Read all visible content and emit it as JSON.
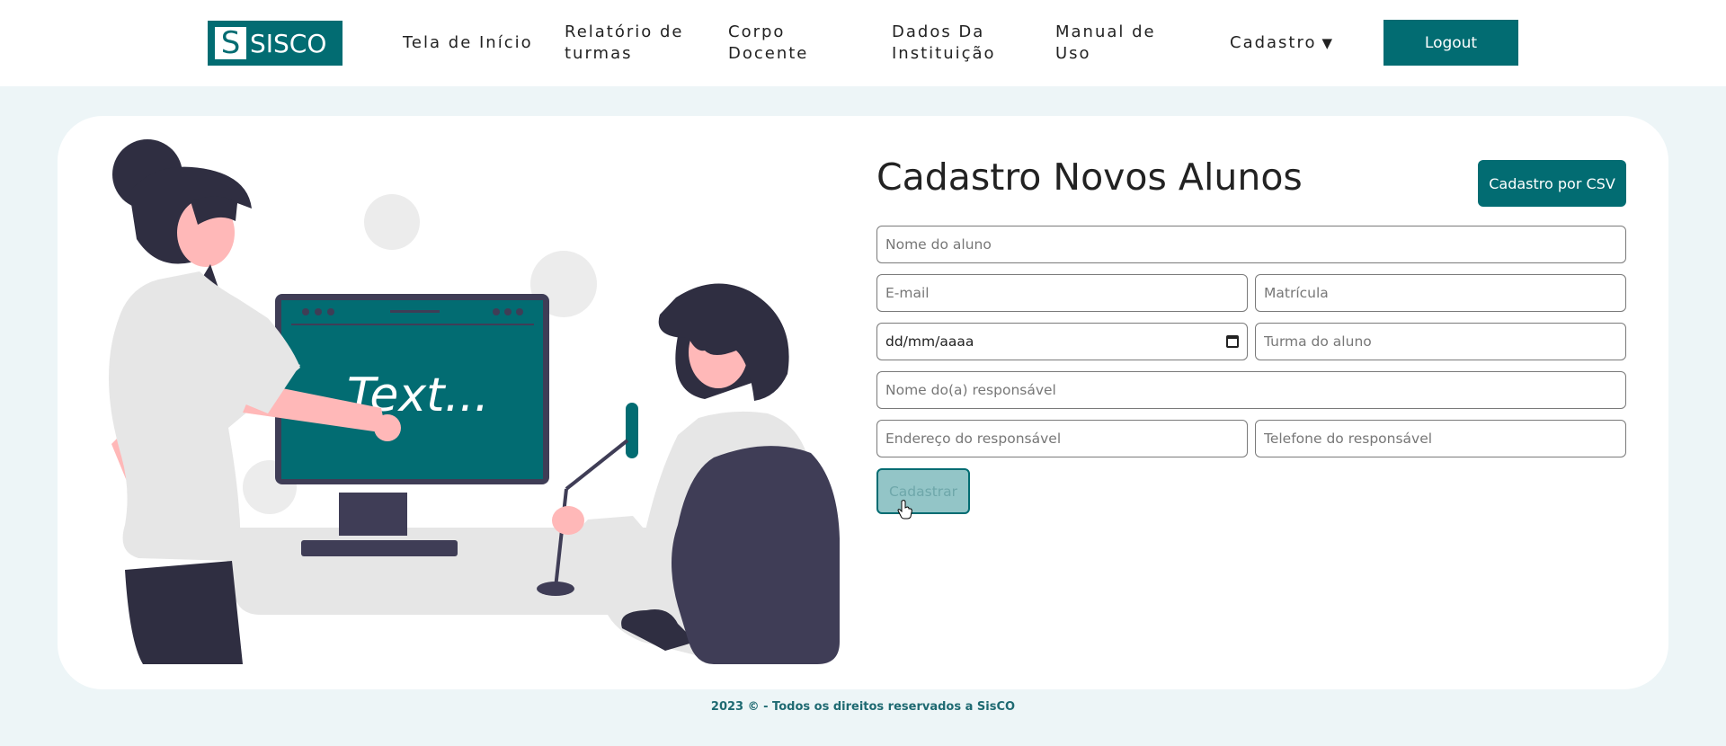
{
  "logo": {
    "letter": "S",
    "text": "SISCO"
  },
  "nav": {
    "items": [
      {
        "label": "Tela de Início"
      },
      {
        "label": "Relatório de turmas"
      },
      {
        "label": "Corpo Docente"
      },
      {
        "label": "Dados Da Instituição"
      },
      {
        "label": "Manual de Uso"
      },
      {
        "label": "Cadastro",
        "caret": "▼"
      }
    ],
    "logout_label": "Logout"
  },
  "illustration": {
    "screen_text": "Text..."
  },
  "form": {
    "title": "Cadastro Novos Alunos",
    "csv_button": "Cadastro por CSV",
    "fields": {
      "nome": {
        "placeholder": "Nome do aluno",
        "value": ""
      },
      "email": {
        "placeholder": "E-mail",
        "value": ""
      },
      "matricula": {
        "placeholder": "Matrícula",
        "value": ""
      },
      "data_nascimento": {
        "value": "dd/mm/aaaa"
      },
      "turma": {
        "placeholder": "Turma do aluno",
        "value": ""
      },
      "responsavel": {
        "placeholder": "Nome do(a) responsável",
        "value": ""
      },
      "endereco": {
        "placeholder": "Endereço do responsável",
        "value": ""
      },
      "telefone": {
        "placeholder": "Telefone do responsável",
        "value": ""
      }
    },
    "submit_label": "Cadastrar"
  },
  "footer": {
    "text": "2023 © - Todos os direitos reservados a SisCO"
  },
  "colors": {
    "brand": "#026c72",
    "background": "#edf5f7",
    "submit_disabled": "#93c5c7",
    "footer_text": "#1f6a72"
  }
}
